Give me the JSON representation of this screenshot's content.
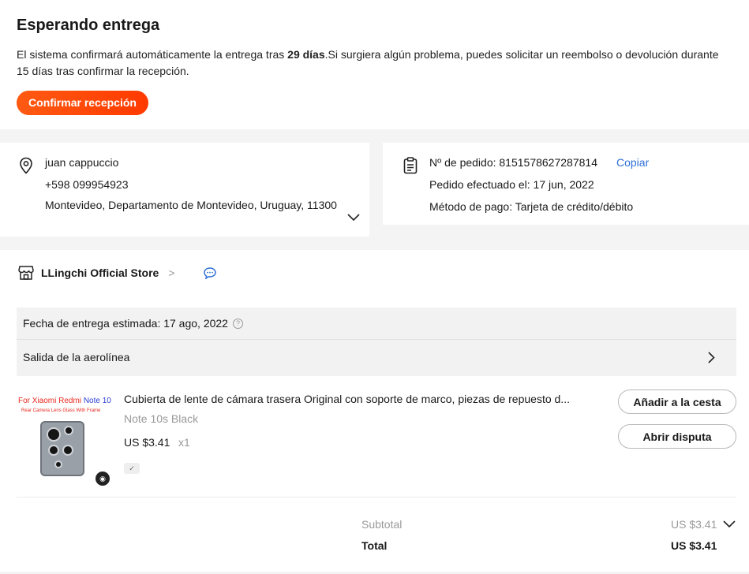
{
  "status": {
    "title": "Esperando entrega",
    "msg_part1": "El sistema confirmará automáticamente la entrega tras ",
    "msg_days": "29 días",
    "msg_part2": ".Si surgiera algún problema, puedes solicitar un reembolso o devolución durante 15 días tras confirmar la recepción.",
    "confirm_button": "Confirmar recepción"
  },
  "address": {
    "name": "juan cappuccio",
    "phone": "+598 099954923",
    "location": "Montevideo, Departamento de Montevideo, Uruguay, 11300",
    "icon": "location-pin-icon"
  },
  "order": {
    "number": "Nº de pedido: 8151578627287814",
    "copy_label": "Copiar",
    "placed": "Pedido efectuado el: 17 jun, 2022",
    "payment": "Método de pago: Tarjeta de crédito/débito",
    "icon": "clipboard-icon"
  },
  "store": {
    "name": "LLingchi Official Store",
    "gt": ">",
    "delivery_estimate": "Fecha de entrega estimada: 17 ago, 2022",
    "qmark": "?",
    "shipping_status": "Salida de la aerolínea"
  },
  "product": {
    "image_text_line1_a": "For Xiaomi Redmi ",
    "image_text_line1_b": "Note 10",
    "image_text_line2": "Rear Camera Lens Glass With Frame",
    "title": "Cubierta de lente de cámara trasera Original con soporte de marco, piezas de repuesto d...",
    "variant": "Note 10s Black",
    "price": "US $3.41",
    "quantity": "x1",
    "add_to_cart": "Añadir a la cesta",
    "dispute": "Abrir disputa"
  },
  "summary": {
    "subtotal_label": "Subtotal",
    "subtotal_value": "US $3.41",
    "total_label": "Total",
    "total_value": "US $3.41"
  },
  "colors": {
    "accent": "#ff4a0a",
    "link": "#2e6fd6"
  }
}
